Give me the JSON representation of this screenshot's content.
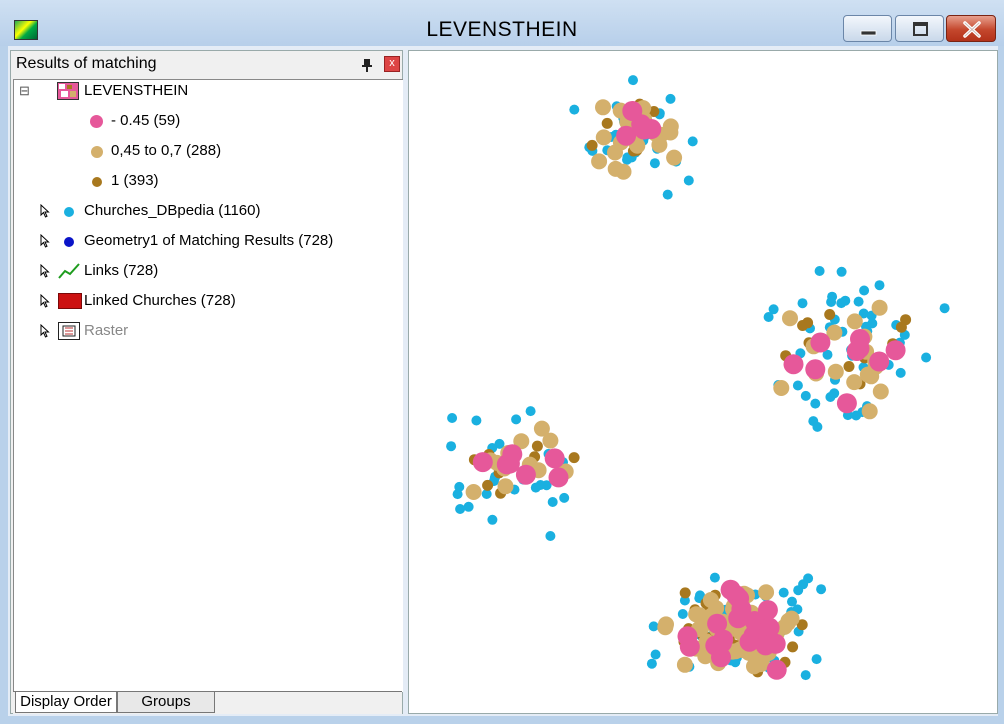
{
  "window": {
    "title": "LEVENSTHEIN"
  },
  "panel": {
    "title": "Results of matching",
    "close_label": "x"
  },
  "tree": {
    "root": {
      "label": "LEVENSTHEIN",
      "expander": "⊟"
    },
    "classes": [
      {
        "label": "- 0.45 (59)",
        "color": "#e6589a"
      },
      {
        "label": "0,45 to  0,7 (288)",
        "color": "#d4b06c"
      },
      {
        "label": "1 (393)",
        "color": "#a8781e"
      }
    ],
    "layers": [
      {
        "label": "Churches_DBpedia (1160)",
        "symbol": "point",
        "color": "#1ab0e0"
      },
      {
        "label": "Geometry1 of Matching Results  (728)",
        "symbol": "point",
        "color": "#0a14c8"
      },
      {
        "label": "Links (728)",
        "symbol": "line",
        "color": "#1e9c1e"
      },
      {
        "label": "Linked Churches (728)",
        "symbol": "region",
        "color": "#cc1111"
      },
      {
        "label": "Raster",
        "symbol": "raster",
        "color": "#888888"
      }
    ]
  },
  "tabs": [
    {
      "label": "Display Order",
      "active": true
    },
    {
      "label": "Groups",
      "active": false
    }
  ],
  "map": {
    "colors": {
      "blue": "#1ab0e0",
      "brown": "#a8781e",
      "tan": "#d4b06c",
      "pink": "#e6589a"
    }
  }
}
